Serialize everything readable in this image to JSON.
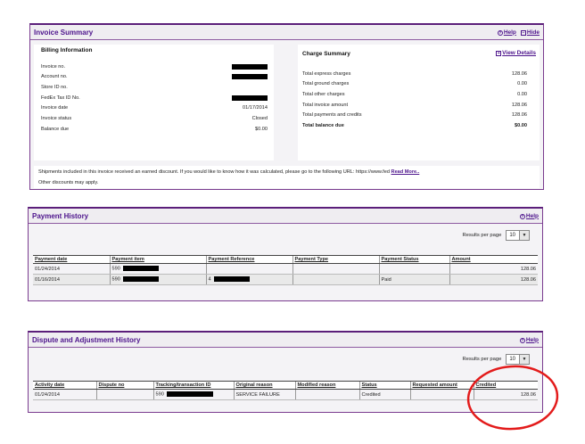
{
  "invoice_summary": {
    "title": "Invoice Summary",
    "help_label": "Help",
    "hide_label": "Hide",
    "billing": {
      "heading": "Billing Information",
      "rows": [
        {
          "label": "Invoice no.",
          "value": ""
        },
        {
          "label": "Account no.",
          "value": ""
        },
        {
          "label": "Store ID no.",
          "value": ""
        },
        {
          "label": "FedEx Tax ID No.",
          "value": ""
        },
        {
          "label": "Invoice date",
          "value": "01/17/2014"
        },
        {
          "label": "Invoice status",
          "value": "Closed"
        },
        {
          "label": "Balance due",
          "value": "$0.00"
        }
      ]
    },
    "charges": {
      "heading": "Charge Summary",
      "view_details_label": "View Details",
      "rows": [
        {
          "label": "Total express charges",
          "value": "128.06"
        },
        {
          "label": "Total ground charges",
          "value": "0.00"
        },
        {
          "label": "Total other charges",
          "value": "0.00"
        },
        {
          "label": "Total invoice amount",
          "value": "128.06"
        },
        {
          "label": "Total payments and credits",
          "value": "128.06"
        },
        {
          "label": "Total balance due",
          "value": "$0.00"
        }
      ]
    },
    "notice": "Shipments included in this invoice received an earned discount. If you would like to know how it was calculated, please go to the following URL: https://www.fed",
    "read_more_label": "Read More..",
    "other_discounts": "Other discounts may apply."
  },
  "payment_history": {
    "title": "Payment History",
    "help_label": "Help",
    "results_label": "Results per page",
    "results_value": "10",
    "columns": [
      "Payment date",
      "Payment item",
      "Payment Reference",
      "Payment Type",
      "Payment Status",
      "Amount"
    ],
    "rows": [
      {
        "date": "01/24/2014",
        "item": "590",
        "reference": "",
        "type": "",
        "status": "",
        "amount": "128.06"
      },
      {
        "date": "01/16/2014",
        "item": "590",
        "reference": "4",
        "type": "",
        "status": "Paid",
        "amount": "128.06"
      }
    ]
  },
  "dispute_history": {
    "title": "Dispute and Adjustment History",
    "help_label": "Help",
    "results_label": "Results per page",
    "results_value": "10",
    "columns": [
      "Activity date",
      "Dispute no",
      "Tracking/transaction ID",
      "Original reason",
      "Modified reason",
      "Status",
      "Requested amount",
      "Credited"
    ],
    "rows": [
      {
        "date": "01/24/2014",
        "dispute_no": "",
        "tracking": "590",
        "original_reason": "SERVICE FAILURE",
        "modified_reason": "",
        "status": "Credited",
        "requested": "",
        "credited": "128.06"
      }
    ]
  },
  "colors": {
    "accent": "#4d148c",
    "annotation": "#e31b1b"
  }
}
